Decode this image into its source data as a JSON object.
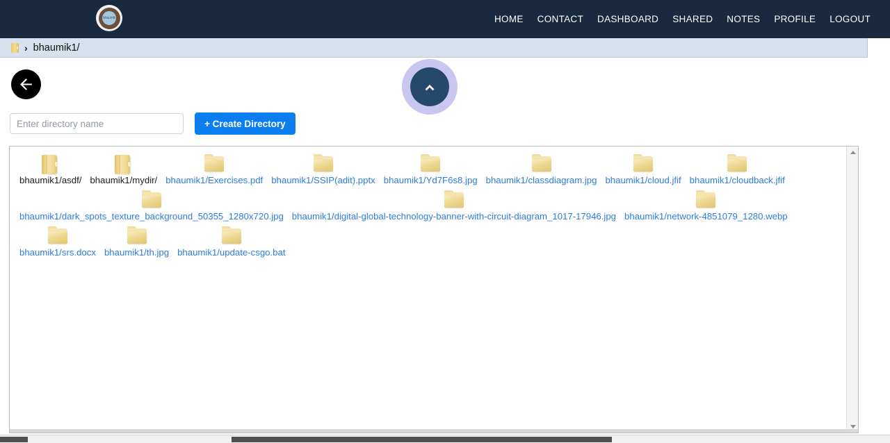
{
  "navbar": {
    "brand_text": "bhaumik",
    "links": [
      {
        "label": "HOME"
      },
      {
        "label": "CONTACT"
      },
      {
        "label": "DASHBOARD"
      },
      {
        "label": "SHARED"
      },
      {
        "label": "NOTES"
      },
      {
        "label": "PROFILE"
      },
      {
        "label": "LOGOUT"
      }
    ]
  },
  "breadcrumb": {
    "separator": "›",
    "path": "bhaumik1/"
  },
  "actions": {
    "back_label": "back-arrow",
    "scroll_top_label": "chevron-up"
  },
  "create_directory": {
    "placeholder": "Enter directory name",
    "input_value": "",
    "button_label": "+ Create Directory"
  },
  "colors": {
    "navbar_bg": "#19293f",
    "breadcrumb_bg": "#d7e1ed",
    "primary_button": "#0d7ef0",
    "link": "#2d7de0",
    "scroll_top_bg": "#26496b",
    "scroll_top_halo": "#c9c6ef"
  },
  "files": [
    {
      "name": "bhaumik1/asdf/",
      "type": "dir"
    },
    {
      "name": "bhaumik1/mydir/",
      "type": "dir"
    },
    {
      "name": "bhaumik1/Exercises.pdf",
      "type": "file"
    },
    {
      "name": "bhaumik1/SSIP(adit).pptx",
      "type": "file"
    },
    {
      "name": "bhaumik1/Yd7F6s8.jpg",
      "type": "file"
    },
    {
      "name": "bhaumik1/classdiagram.jpg",
      "type": "file"
    },
    {
      "name": "bhaumik1/cloud.jfif",
      "type": "file"
    },
    {
      "name": "bhaumik1/cloudback.jfif",
      "type": "file"
    },
    {
      "name": "bhaumik1/dark_spots_texture_background_50355_1280x720.jpg",
      "type": "file"
    },
    {
      "name": "bhaumik1/digital-global-technology-banner-with-circuit-diagram_1017-17946.jpg",
      "type": "file"
    },
    {
      "name": "bhaumik1/network-4851079_1280.webp",
      "type": "file"
    },
    {
      "name": "bhaumik1/srs.docx",
      "type": "file"
    },
    {
      "name": "bhaumik1/th.jpg",
      "type": "file"
    },
    {
      "name": "bhaumik1/update-csgo.bat",
      "type": "file"
    }
  ]
}
